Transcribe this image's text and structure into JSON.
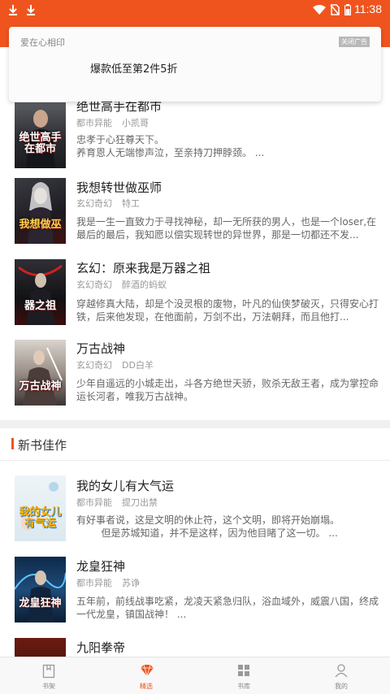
{
  "status_bar": {
    "time": "11:38",
    "download_icon": "download-icon",
    "colors": {
      "bg": "#f0541e"
    }
  },
  "notification": {
    "app_name": "爱在心相印",
    "ad_label": "关闭广告",
    "message": "爆款低至第2件5折"
  },
  "books_top": [
    {
      "title": "绝世高手在都市",
      "cover_text": "绝世高手在都市",
      "category": "都市异能",
      "author": "小凯哥",
      "desc": "忠孝于心狂尊天下。\n养育恩人无端惨声泣，至亲持刀押脖颈。 ..."
    },
    {
      "title": "我想转世做巫师",
      "cover_text": "我想做巫",
      "category": "玄幻奇幻",
      "author": "特工",
      "desc": "我是一生一直致力于寻找神秘，却一无所获的男人，也是一个loser,在最后的最后，我知愿以偿实现转世的异世界，那是一切都还不发..."
    },
    {
      "title": "玄幻：原来我是万器之祖",
      "cover_text": "器之祖",
      "category": "玄幻奇幻",
      "author": "醉酒的蚂蚁",
      "desc": "穿越修真大陆，却是个没灵根的废物，叶凡的仙侠梦破灭，只得安心打铁，后来他发现，在他面前，万剑不出，万法朝拜，而且他打..."
    },
    {
      "title": "万古战神",
      "cover_text": "万古战神",
      "category": "玄幻奇幻",
      "author": "DD白羊",
      "desc": "少年自遥远的小城走出，斗各方绝世天骄，败杀无敌王者，成为掌控命运长河者，唯我万古战神。"
    }
  ],
  "section": {
    "title": "新书佳作"
  },
  "books_new": [
    {
      "title": "我的女儿有大气运",
      "cover_text": "我的女儿有气运",
      "category": "都市异能",
      "author": "提刀出禁",
      "desc": "有好事者说，这是文明的休止符，这个文明，即将开始崩塌。\n        但是苏城知道，并不是这样，因为他目睹了这一切。 ..."
    },
    {
      "title": "龙皇狂神",
      "cover_text": "龙皇狂神",
      "category": "都市异能",
      "author": "苏诤",
      "desc": "五年前，前线战事吃紧，龙凌天紧急归队，浴血域外，威震八国，终成一代龙皇，镇国战神！ ..."
    },
    {
      "title": "九阳拳帝",
      "cover_text": "",
      "category": "",
      "author": "",
      "desc": ""
    }
  ],
  "bottom_nav": [
    {
      "label": "书架",
      "icon": "bookshelf-icon",
      "active": false
    },
    {
      "label": "精选",
      "icon": "diamond-icon",
      "active": true
    },
    {
      "label": "书库",
      "icon": "grid-icon",
      "active": false
    },
    {
      "label": "我的",
      "icon": "user-icon",
      "active": false
    }
  ],
  "colors": {
    "accent": "#f0541e"
  }
}
